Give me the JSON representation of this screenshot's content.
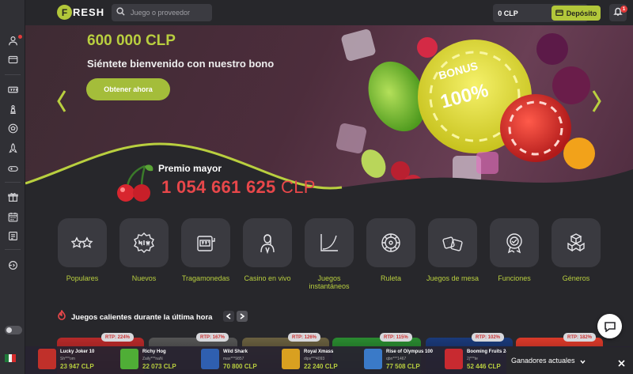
{
  "header": {
    "logo_letter": "F",
    "logo_text": "RESH",
    "search_placeholder": "Juego o proveedor",
    "balance": "0 CLP",
    "deposit_label": "Depósito",
    "notification_count": "1"
  },
  "hero": {
    "amount": "600 000 CLP",
    "subtitle": "Siéntete bienvenido con nuestro bono",
    "cta_label": "Obtener ahora",
    "chip_text_1": "BONUS",
    "chip_text_2": "100%"
  },
  "jackpot": {
    "title": "Premio mayor",
    "amount": "1 054 661 625",
    "currency": "CLP"
  },
  "categories": [
    {
      "label": "Populares",
      "icon": "stars-icon"
    },
    {
      "label": "Nuevos",
      "icon": "new-badge-icon"
    },
    {
      "label": "Tragamonedas",
      "icon": "slot-machine-icon"
    },
    {
      "label": "Casino en vivo",
      "icon": "live-dealer-icon"
    },
    {
      "label": "Juegos instantáneos",
      "icon": "instant-curve-icon"
    },
    {
      "label": "Ruleta",
      "icon": "roulette-icon"
    },
    {
      "label": "Juegos de mesa",
      "icon": "dice-icon"
    },
    {
      "label": "Funciones",
      "icon": "features-badge-icon"
    },
    {
      "label": "Géneros",
      "icon": "cubes-icon"
    }
  ],
  "hot_games": {
    "title": "Juegos calientes durante la última hora",
    "rtp": [
      "RTP: 224%",
      "RTP: 167%",
      "RTP: 126%",
      "RTP: 115%",
      "RTP: 102%",
      "RTP: 182%"
    ]
  },
  "ticker": [
    {
      "name": "Lucky Joker 10",
      "user": "Sh***om",
      "amount": "23 947 CLP"
    },
    {
      "name": "Richy Hog",
      "user": "Zaily***naN",
      "amount": "22 073 CLP"
    },
    {
      "name": "Wild Shark",
      "user": "max***9857",
      "amount": "70 800 CLP"
    },
    {
      "name": "Royal Xmass",
      "user": "dips***4093",
      "amount": "22 240 CLP"
    },
    {
      "name": "Rise of Olympus 100",
      "user": "qbn***1467",
      "amount": "77 508 CLP"
    },
    {
      "name": "Booming Fruits 243",
      "user": "2j***te",
      "amount": "52 446 CLP"
    }
  ],
  "winners_label": "Ganadores actuales",
  "colors": {
    "accent": "#b2c73a",
    "jackpot": "#e8474a",
    "background": "#27272b"
  }
}
